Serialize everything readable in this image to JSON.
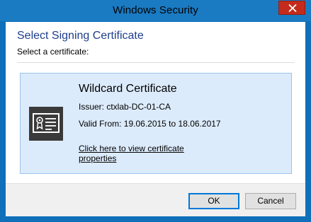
{
  "window": {
    "title": "Windows Security"
  },
  "dialog": {
    "heading": "Select Signing Certificate",
    "subtitle": "Select a certificate:"
  },
  "certificate": {
    "name": "Wildcard Certificate",
    "issuer": "Issuer: ctxlab-DC-01-CA",
    "valid": "Valid From: 19.06.2015 to 18.06.2017",
    "link": "Click here to view certificate properties",
    "icon": "certificate-icon"
  },
  "buttons": {
    "ok": "OK",
    "cancel": "Cancel"
  },
  "colors": {
    "titlebar": "#1a7bc3",
    "close": "#c42b1c",
    "heading": "#1e3f8c",
    "tile_bg": "#dcebfb",
    "tile_border": "#9bc3ea"
  }
}
